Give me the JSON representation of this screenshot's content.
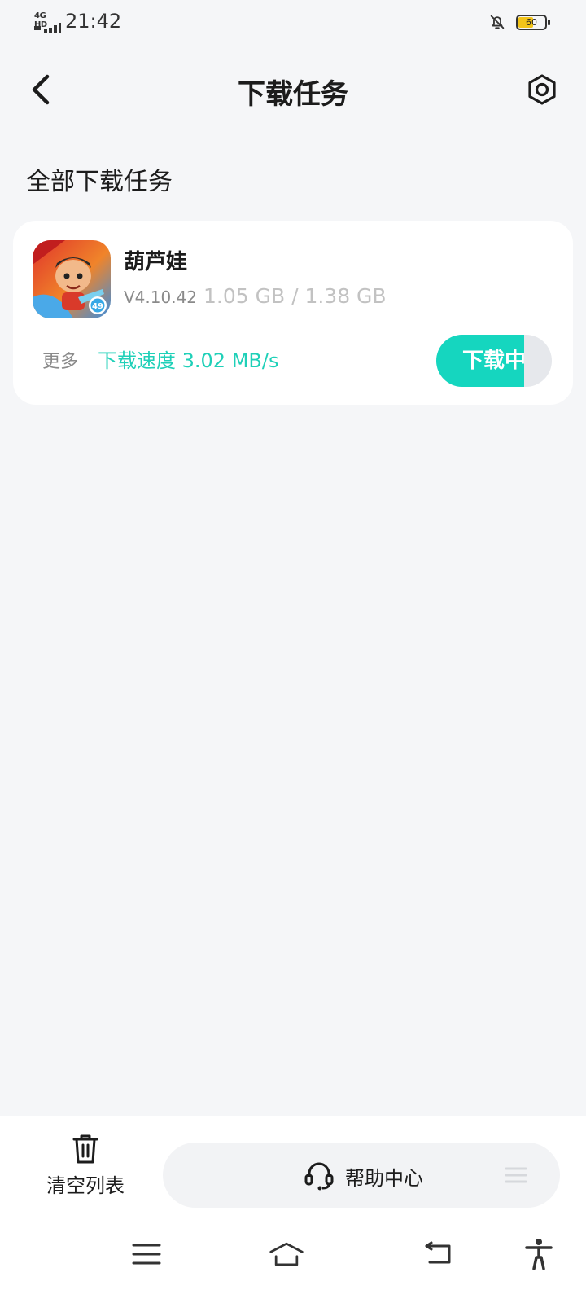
{
  "status_bar": {
    "network": "4G HD",
    "time": "21:42",
    "battery": "60",
    "battery_level": 0.6
  },
  "header": {
    "title": "下载任务"
  },
  "section": {
    "title": "全部下载任务"
  },
  "task": {
    "name": "葫芦娃",
    "version": "V4.10.42",
    "size": "1.05 GB / 1.38 GB",
    "more_label": "更多",
    "speed": "下载速度 3.02 MB/s",
    "status_label": "下载中",
    "progress": 0.76
  },
  "actions": {
    "clear_label": "清空列表",
    "help_label": "帮助中心"
  },
  "colors": {
    "accent": "#15d6bf",
    "accent_text": "#1fd0b8",
    "background": "#f5f6f8",
    "card": "#ffffff",
    "battery": "#f3c418"
  },
  "icons": {
    "back": "chevron-left-icon",
    "settings": "hexagon-settings-icon",
    "clear": "trash-icon",
    "help": "headset-icon",
    "notifications": "bell-off-icon"
  }
}
